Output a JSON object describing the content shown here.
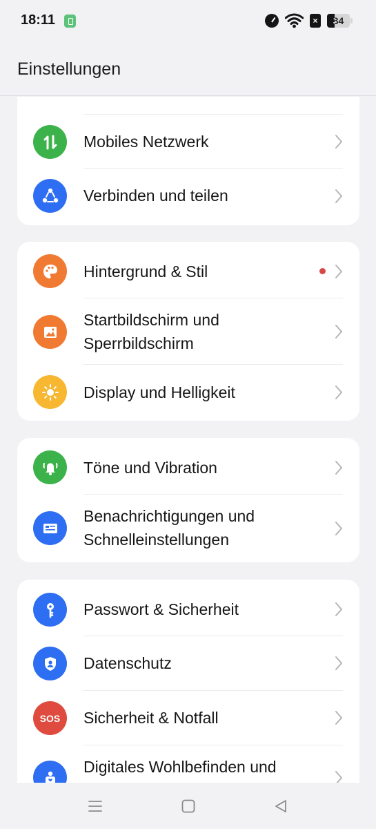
{
  "status_bar": {
    "time": "18:11",
    "battery_level": "34",
    "icons": [
      "sim-card-icon",
      "speed-icon",
      "wifi-icon",
      "no-sim-icon",
      "battery-icon"
    ]
  },
  "header": {
    "title": "Einstellungen"
  },
  "groups": [
    {
      "items": [
        {
          "label": "Mobiles Netzwerk",
          "icon": "arrows-updown-icon",
          "color": "#3cb24a"
        },
        {
          "label": "Verbinden und teilen",
          "icon": "share-network-icon",
          "color": "#2e6ef2"
        }
      ]
    },
    {
      "items": [
        {
          "label": "Hintergrund & Stil",
          "icon": "palette-icon",
          "color": "#f07a32",
          "badge": "red-dot"
        },
        {
          "label": "Startbildschirm und Sperrbildschirm",
          "icon": "image-icon",
          "color": "#f07a32"
        },
        {
          "label": "Display und Helligkeit",
          "icon": "sun-icon",
          "color": "#f7b731"
        }
      ]
    },
    {
      "items": [
        {
          "label": "Töne und Vibration",
          "icon": "bell-icon",
          "color": "#3cb24a"
        },
        {
          "label": "Benachrichtigungen und Schnelleinstellungen",
          "icon": "notification-card-icon",
          "color": "#2e6ef2"
        }
      ]
    },
    {
      "items": [
        {
          "label": "Passwort & Sicherheit",
          "icon": "key-icon",
          "color": "#2e6ef2"
        },
        {
          "label": "Datenschutz",
          "icon": "shield-user-icon",
          "color": "#2e6ef2"
        },
        {
          "label": "Sicherheit & Notfall",
          "icon": "sos-icon",
          "color": "#e04b3f",
          "icon_text": "SOS"
        },
        {
          "label": "Digitales Wohlbefinden und",
          "icon": "person-heart-icon",
          "color": "#2e6ef2"
        }
      ]
    }
  ],
  "nav_bar": {
    "icons": [
      "menu-icon",
      "home-icon",
      "back-icon"
    ]
  }
}
